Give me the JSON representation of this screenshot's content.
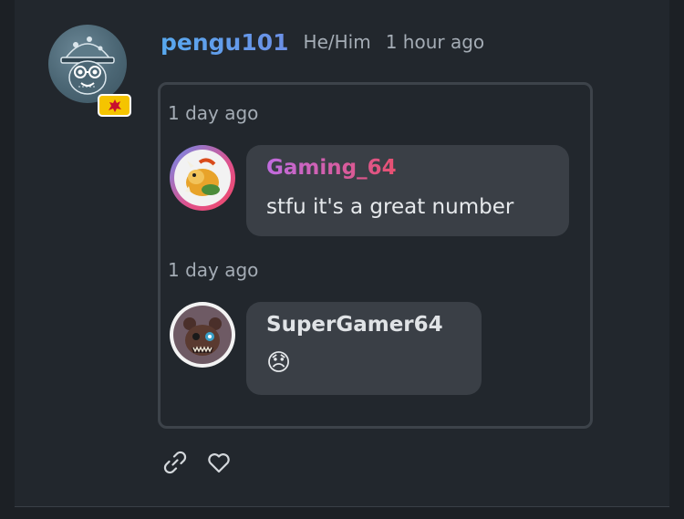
{
  "post": {
    "username": "pengu101",
    "pronouns": "He/Him",
    "time": "1 hour ago",
    "avatar_icon": "penguin-avatar-icon",
    "badge_icon": "welsh-flag-icon",
    "badge_color": "#f5c400"
  },
  "replies": [
    {
      "time": "1 day ago",
      "author": "Gaming_64",
      "text": "stfu it's a great number",
      "avatar_icon": "bowser-avatar-icon"
    },
    {
      "time": "1 day ago",
      "author": "SuperGamer64",
      "text": "😞",
      "avatar_icon": "fnaf-bear-avatar-icon"
    }
  ],
  "actions": {
    "link_icon": "link-icon",
    "like_icon": "heart-icon"
  },
  "colors": {
    "background": "#22272d",
    "bubble": "#3a3f46",
    "muted_text": "#a4acb5",
    "username_gradient": [
      "#58a9ef",
      "#6c8fe6"
    ],
    "reply_name_gradient": [
      "#c06ce0",
      "#e75070"
    ]
  }
}
